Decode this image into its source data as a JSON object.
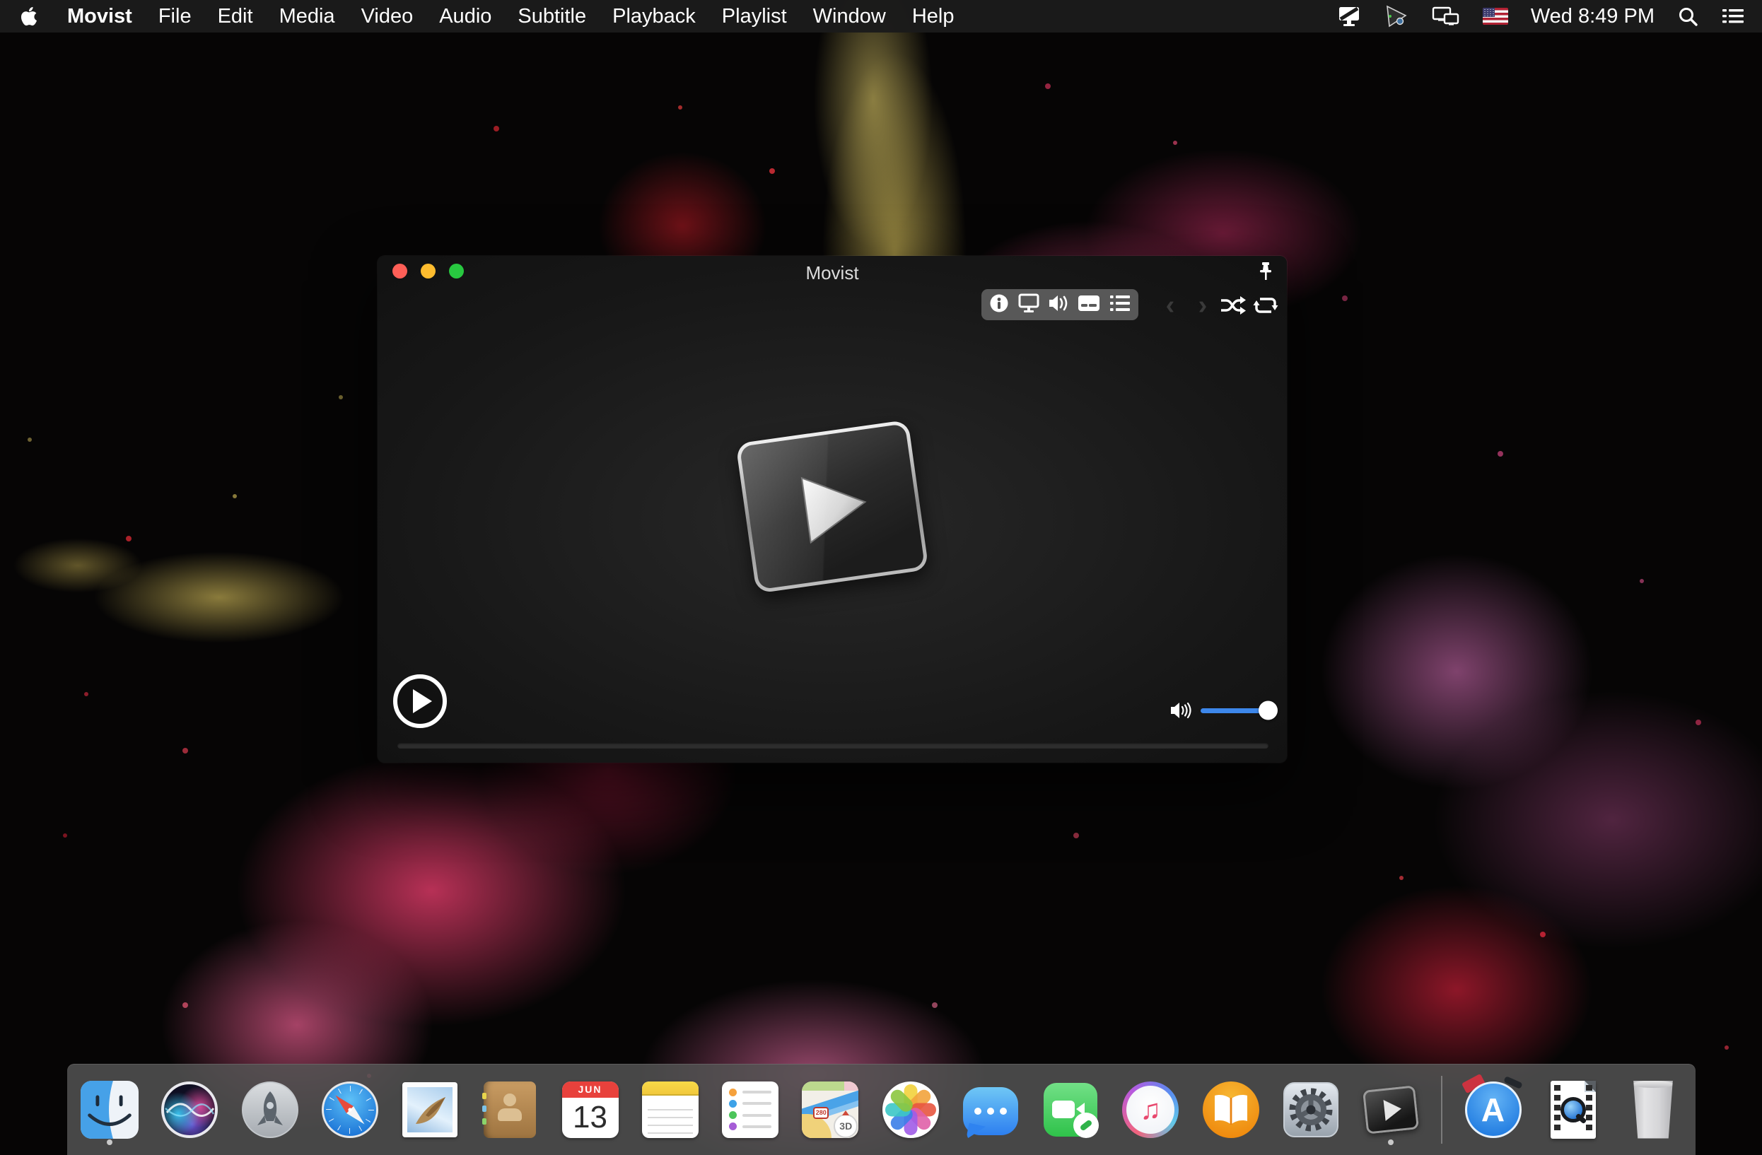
{
  "menubar": {
    "apple_icon": "apple-logo",
    "app_menu": "Movist",
    "menus": [
      "File",
      "Edit",
      "Media",
      "Video",
      "Audio",
      "Subtitle",
      "Playback",
      "Playlist",
      "Window",
      "Help"
    ],
    "status_icons": [
      "display-status-icon",
      "media-player-status-icon",
      "screen-mirroring-icon",
      "us-flag-input-source"
    ],
    "clock": "Wed 8:49 PM",
    "right_icons": [
      "spotlight-search-icon",
      "notification-center-icon"
    ]
  },
  "window": {
    "title": "Movist",
    "traffic_lights": {
      "close": "#ff5f57",
      "minimize": "#febc2e",
      "zoom": "#28c840"
    },
    "toolbar_icons": [
      "info-icon",
      "display-icon",
      "volume-icon",
      "subtitle-icon",
      "playlist-icon"
    ],
    "nav": {
      "prev": "‹",
      "next": "›"
    },
    "transport_icons": [
      "shuffle-icon",
      "repeat-icon"
    ],
    "pin_icon": "pin-icon",
    "volume_accent": "#3d87ea",
    "volume_level": "100%"
  },
  "dock": {
    "apps": [
      "Finder",
      "Siri",
      "Launchpad",
      "Safari",
      "Mail",
      "Contacts",
      "Calendar",
      "Notes",
      "Reminders",
      "Maps",
      "Photos",
      "Messages",
      "FaceTime",
      "iTunes",
      "iBooks",
      "System Preferences",
      "Movist",
      "App Store",
      "QuickTime File",
      "Trash"
    ],
    "running": [
      "Finder",
      "Movist"
    ],
    "calendar": {
      "month": "JUN",
      "day": "13"
    },
    "maps": {
      "route": "280",
      "mode": "3D"
    },
    "itunes_note": "♫",
    "appstore_letter": "A"
  }
}
